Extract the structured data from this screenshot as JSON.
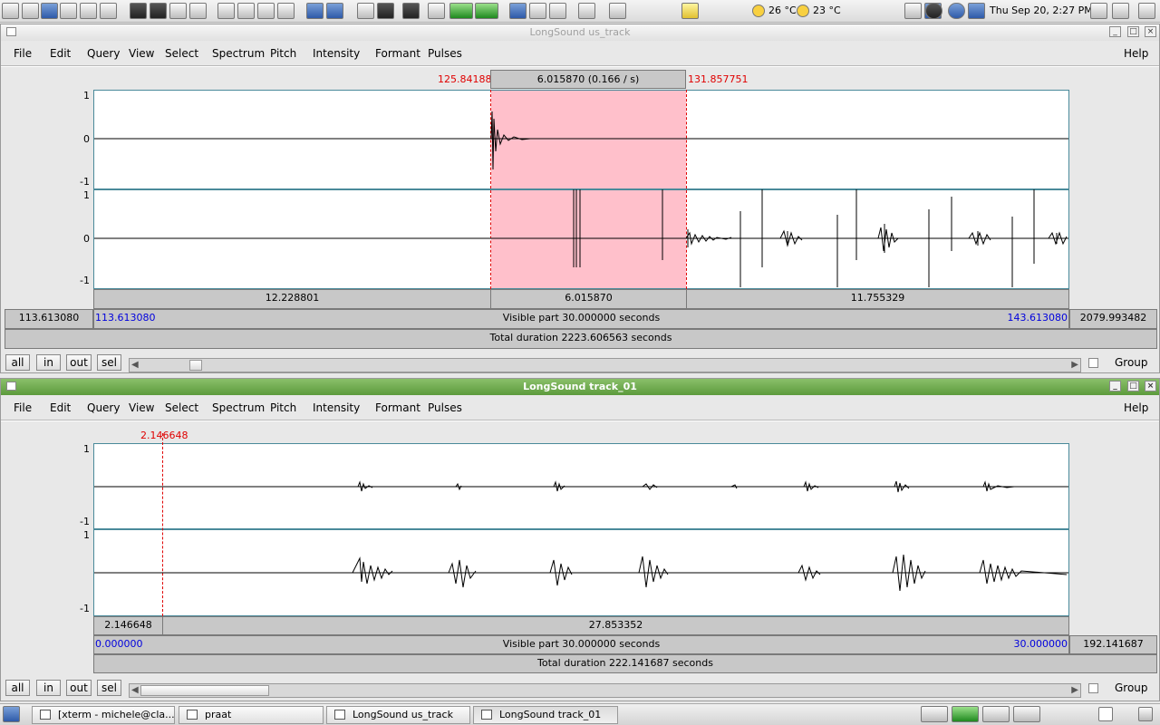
{
  "topbar": {
    "weather1": "26 °C",
    "weather2": "23 °C",
    "clock": "Thu Sep 20,  2:27 PM"
  },
  "menus": [
    "File",
    "Edit",
    "Query",
    "View",
    "Select",
    "Spectrum",
    "Pitch",
    "Intensity",
    "Formant",
    "Pulses"
  ],
  "help": "Help",
  "window1": {
    "title": "LongSound us_track",
    "sel_start": "125.841881",
    "sel_end": "131.857751",
    "sel_header": "6.015870 (0.166 / s)",
    "y_top": "1",
    "y_zero": "0",
    "y_bottom": "-1",
    "y2_top": "1",
    "y2_zero": "0",
    "y2_bottom": "-1",
    "seg_left": "12.228801",
    "seg_mid": "6.015870",
    "seg_right": "11.755329",
    "vis_left_outer": "113.613080",
    "vis_left": "113.613080",
    "visible_part": "Visible part 30.000000 seconds",
    "vis_right": "143.613080",
    "vis_right_outer": "2079.993482",
    "total": "Total duration 2223.606563 seconds",
    "buttons": [
      "all",
      "in",
      "out",
      "sel"
    ],
    "group": "Group"
  },
  "window2": {
    "title": "LongSound track_01",
    "cursor": "2.146648",
    "y_top": "1",
    "y_bottom": "-1",
    "y2_top": "1",
    "y2_bottom": "-1",
    "seg_left": "2.146648",
    "seg_right": "27.853352",
    "vis_left": "0.000000",
    "visible_part": "Visible part 30.000000 seconds",
    "vis_right": "30.000000",
    "vis_right_outer": "192.141687",
    "total": "Total duration 222.141687 seconds",
    "buttons": [
      "all",
      "in",
      "out",
      "sel"
    ],
    "group": "Group"
  },
  "taskbar": {
    "tasks": [
      "[xterm - michele@cla...",
      "praat",
      "LongSound us_track",
      "LongSound track_01"
    ]
  }
}
